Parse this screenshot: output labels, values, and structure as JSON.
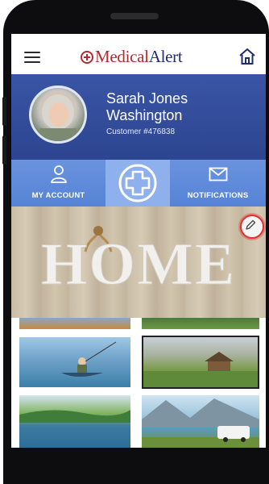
{
  "header": {
    "brand_medical": "Medical",
    "brand_alert": "Alert",
    "menu_icon": "hamburger-icon",
    "home_icon": "home-icon"
  },
  "profile": {
    "name_line1": "Sarah Jones",
    "name_line2": "Washington",
    "customer": "Customer #476838"
  },
  "nav": {
    "account_label": "MY ACCOUNT",
    "notifications_label": "NOTIFICATIONS",
    "center_icon": "medical-cross-icon"
  },
  "banner": {
    "word": "HOME",
    "edit_icon": "pencil-icon"
  },
  "colors": {
    "brand_red": "#b5282e",
    "brand_navy": "#1f2d6b",
    "profile_blue": "#3a55a6",
    "nav_blue": "#5683d6",
    "highlight_red": "#e23030"
  },
  "gallery": {
    "tiles": [
      "beach-boat",
      "fields",
      "kayak-fishing",
      "farm-landscape",
      "lake-forest",
      "camper-lake"
    ]
  }
}
